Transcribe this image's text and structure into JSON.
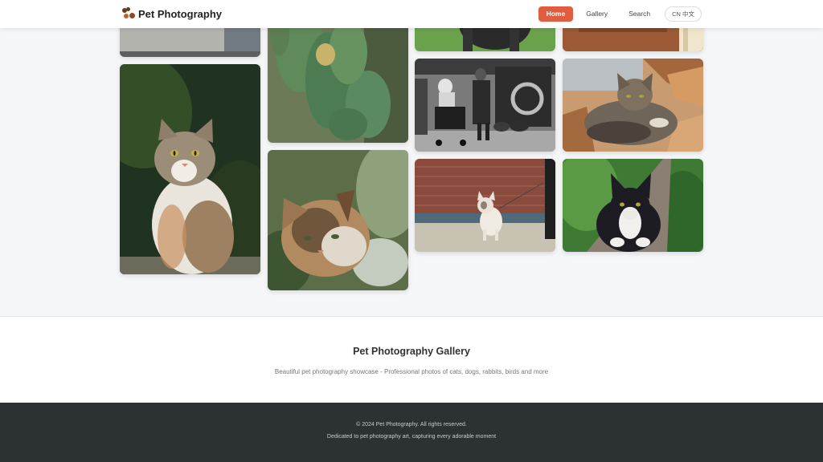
{
  "header": {
    "brand_name": "Pet Photography",
    "nav": {
      "home": "Home",
      "gallery": "Gallery",
      "search": "Search",
      "language": "CN 中文"
    }
  },
  "gallery": {
    "photos": [
      {
        "subject": "stone ledge"
      },
      {
        "subject": "tabby and white cat sitting"
      },
      {
        "subject": "cactus"
      },
      {
        "subject": "calico cat among olive leaves"
      },
      {
        "subject": "black dog on grass"
      },
      {
        "subject": "street scene with stroller and dogs"
      },
      {
        "subject": "french bulldog on leash"
      },
      {
        "subject": "room interior"
      },
      {
        "subject": "tabby cat lying on firewood"
      },
      {
        "subject": "black and white cat on bench"
      }
    ]
  },
  "footer": {
    "title": "Pet Photography Gallery",
    "description": "Beautiful pet photography showcase - Professional photos of cats, dogs, rabbits, birds and more",
    "copyright": "© 2024 Pet Photography. All rights reserved.",
    "tagline": "Dedicated to pet photography art, capturing every adorable moment"
  },
  "colors": {
    "accent": "#e05d3f",
    "page_bg": "#f5f6f8",
    "footer_dark": "#2c3134"
  }
}
